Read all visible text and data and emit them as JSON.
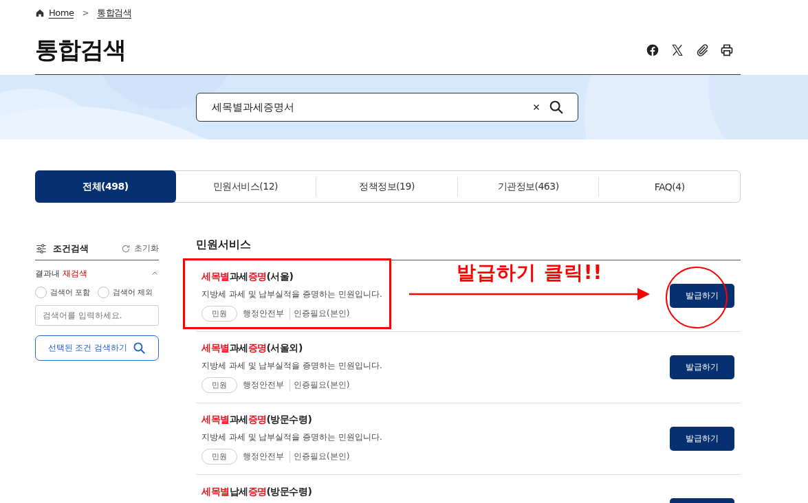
{
  "breadcrumb": [
    {
      "label": "Home",
      "kind": "home"
    },
    {
      "label": "통합검색",
      "kind": "page"
    }
  ],
  "page_title": "통합검색",
  "breadcrumb_separator": ">",
  "share_icons": [
    {
      "kind": "facebook"
    },
    {
      "kind": "x"
    },
    {
      "kind": "link"
    },
    {
      "kind": "print"
    }
  ],
  "search": {
    "value": "세목별과세증명서"
  },
  "tabs": [
    {
      "label": "전체(498)",
      "selected": true
    },
    {
      "label": "민원서비스(12)",
      "selected": false
    },
    {
      "label": "정책정보(19)",
      "selected": false
    },
    {
      "label": "기관정보(463)",
      "selected": false
    },
    {
      "label": "FAQ(4)",
      "selected": false
    }
  ],
  "sidebar": {
    "title": "조건검색",
    "reset": "초기화",
    "section": {
      "title_parts": [
        {
          "text": "결과내 ",
          "accent": false
        },
        {
          "text": "재검색",
          "accent": true
        }
      ],
      "expanded": true
    },
    "radios": [
      {
        "label": "검색어 포함",
        "selected": false
      },
      {
        "label": "검색어 제외",
        "selected": false
      }
    ],
    "placeholder": "검색어를 입력하세요.",
    "submit": "선택된 조건 검색하기"
  },
  "results": {
    "heading": "민원서비스",
    "items": [
      {
        "title": [
          {
            "text": "세목별",
            "highlight": true
          },
          {
            "text": "과세",
            "highlight": false
          },
          {
            "text": "증명",
            "highlight": true
          },
          {
            "text": "(서울)",
            "highlight": false
          }
        ],
        "description": "지방세 과세 및 납부실적을 증명하는 민원입니다.",
        "tag": "민원",
        "agency": "행정안전부",
        "auth": "인증필요(본인)",
        "button": "발급하기"
      },
      {
        "title": [
          {
            "text": "세목별",
            "highlight": true
          },
          {
            "text": "과세",
            "highlight": false
          },
          {
            "text": "증명",
            "highlight": true
          },
          {
            "text": "(서울외)",
            "highlight": false
          }
        ],
        "description": "지방세 과세 및 납부실적을 증명하는 민원입니다.",
        "tag": "민원",
        "agency": "행정안전부",
        "auth": "인증필요(본인)",
        "button": "발급하기"
      },
      {
        "title": [
          {
            "text": "세목별",
            "highlight": true
          },
          {
            "text": "과세",
            "highlight": false
          },
          {
            "text": "증명",
            "highlight": true
          },
          {
            "text": "(방문수령)",
            "highlight": false
          }
        ],
        "description": "지방세 과세 및 납부실적을 증명하는 민원입니다.",
        "tag": "민원",
        "agency": "행정안전부",
        "auth": "인증필요(본인)",
        "button": "발급하기"
      },
      {
        "title": [
          {
            "text": "세목별",
            "highlight": true
          },
          {
            "text": "납세",
            "highlight": false
          },
          {
            "text": "증명",
            "highlight": true
          },
          {
            "text": "(방문수령)",
            "highlight": false
          }
        ]
      }
    ]
  },
  "annotations": [
    {
      "kind": "box"
    },
    {
      "kind": "label",
      "text": "발급하기 클릭!!"
    },
    {
      "kind": "arrow"
    },
    {
      "kind": "circle"
    }
  ]
}
